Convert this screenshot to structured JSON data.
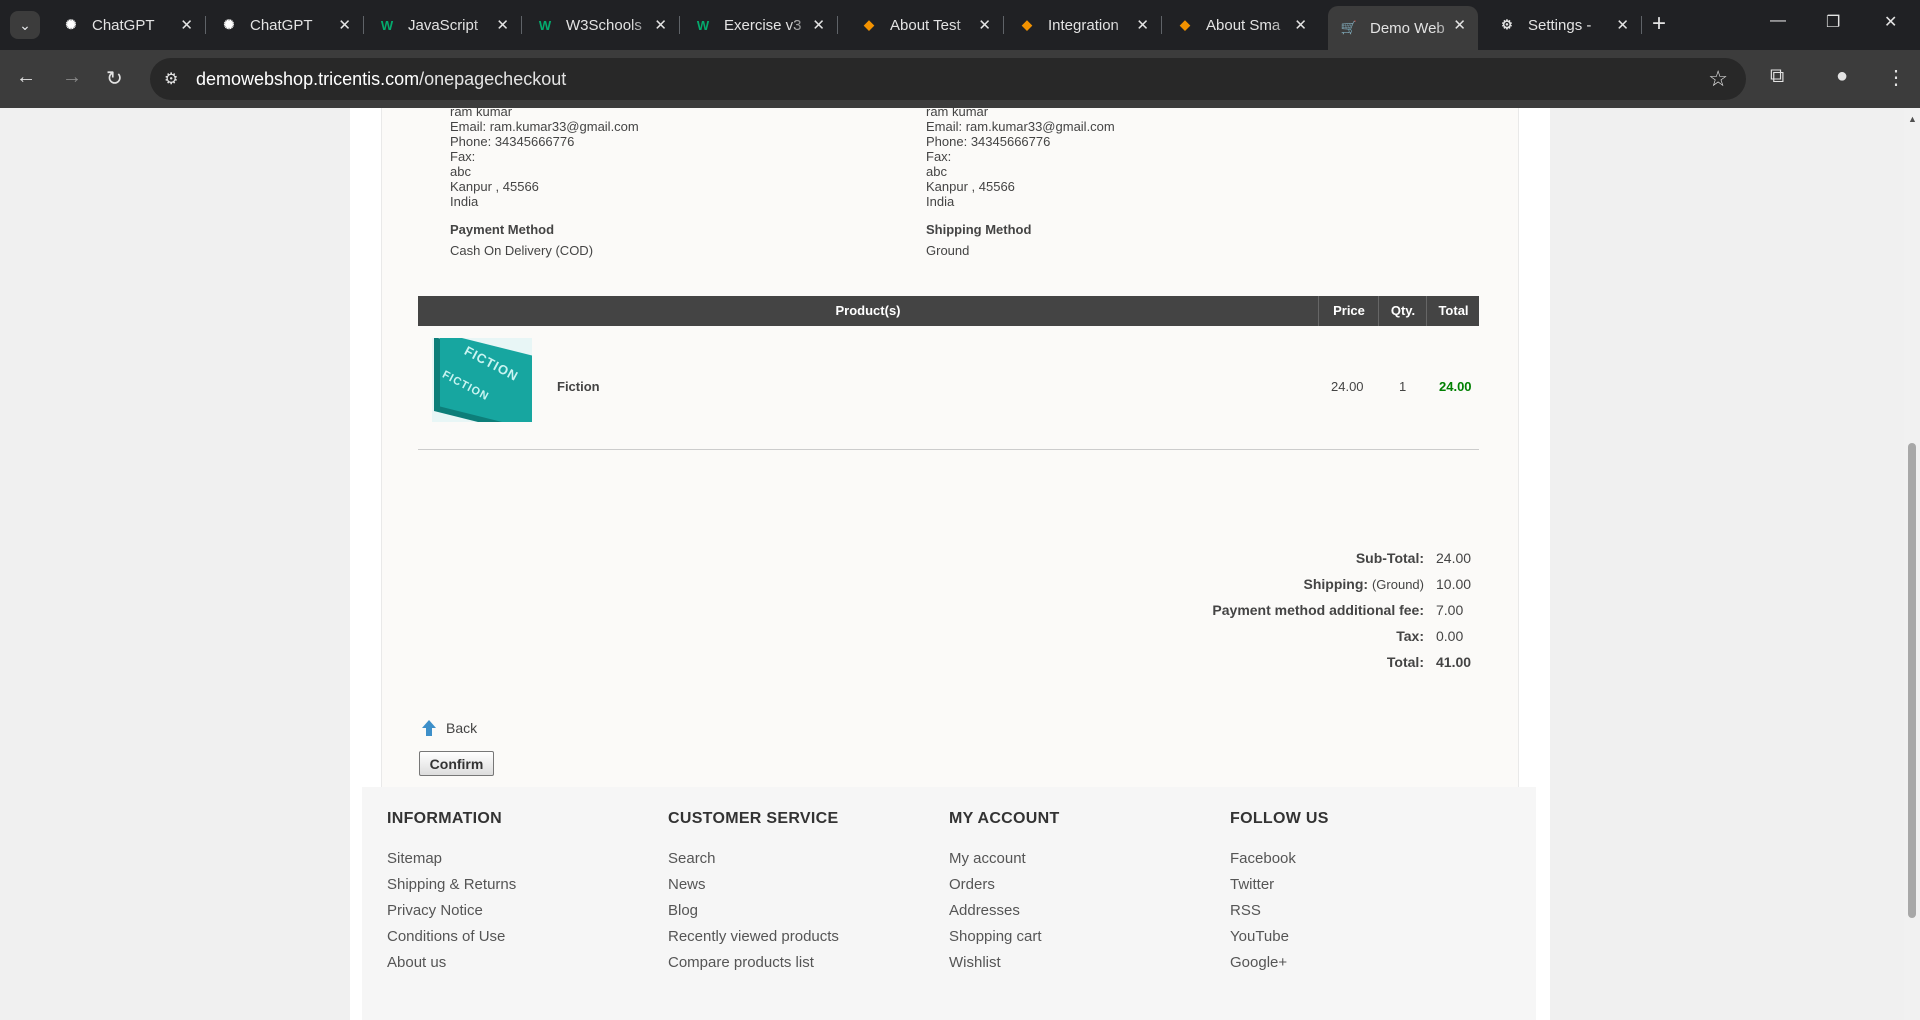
{
  "browser": {
    "tabs": [
      {
        "title": "ChatGPT",
        "icon": "chatgpt-icon"
      },
      {
        "title": "ChatGPT",
        "icon": "chatgpt-icon"
      },
      {
        "title": "JavaScript",
        "icon": "w3schools-icon"
      },
      {
        "title": "W3Schools",
        "icon": "w3schools-icon"
      },
      {
        "title": "Exercise v3",
        "icon": "w3schools-icon"
      },
      {
        "title": "About Test",
        "icon": "tosca-icon"
      },
      {
        "title": "Integration",
        "icon": "tosca-icon"
      },
      {
        "title": "About Sma",
        "icon": "tosca-icon"
      },
      {
        "title": "Demo Web",
        "icon": "cart-icon"
      },
      {
        "title": "Settings - ",
        "icon": "gear-icon"
      }
    ],
    "url_host": "demowebshop.tricentis.com",
    "url_path": "/onepagecheckout"
  },
  "billing": {
    "name": "ram kumar",
    "email": "Email: ram.kumar33@gmail.com",
    "phone": "Phone: 34345666776",
    "fax": "Fax:",
    "address": "abc",
    "city": "Kanpur , 45566",
    "country": "India"
  },
  "shipping": {
    "name": "ram kumar",
    "email": "Email: ram.kumar33@gmail.com",
    "phone": "Phone: 34345666776",
    "fax": "Fax:",
    "address": "abc",
    "city": "Kanpur , 45566",
    "country": "India"
  },
  "payment_method": {
    "label": "Payment Method",
    "value": "Cash On Delivery (COD)"
  },
  "shipping_method": {
    "label": "Shipping Method",
    "value": "Ground"
  },
  "cart": {
    "headers": {
      "products": "Product(s)",
      "price": "Price",
      "qty": "Qty.",
      "total": "Total"
    },
    "items": [
      {
        "name": "Fiction",
        "price": "24.00",
        "qty": "1",
        "total": "24.00",
        "image_text": "FICTION"
      }
    ]
  },
  "totals": {
    "subtotal_label": "Sub-Total:",
    "subtotal": "24.00",
    "shipping_label": "Shipping:",
    "shipping_note": "(Ground)",
    "shipping": "10.00",
    "fee_label": "Payment method additional fee:",
    "fee": "7.00",
    "tax_label": "Tax:",
    "tax": "0.00",
    "total_label": "Total:",
    "total": "41.00"
  },
  "actions": {
    "back": "Back",
    "confirm": "Confirm"
  },
  "footer": {
    "columns": [
      {
        "title": "INFORMATION",
        "links": [
          "Sitemap",
          "Shipping & Returns",
          "Privacy Notice",
          "Conditions of Use",
          "About us"
        ]
      },
      {
        "title": "CUSTOMER SERVICE",
        "links": [
          "Search",
          "News",
          "Blog",
          "Recently viewed products",
          "Compare products list"
        ]
      },
      {
        "title": "MY ACCOUNT",
        "links": [
          "My account",
          "Orders",
          "Addresses",
          "Shopping cart",
          "Wishlist"
        ]
      },
      {
        "title": "FOLLOW US",
        "links": [
          "Facebook",
          "Twitter",
          "RSS",
          "YouTube",
          "Google+"
        ]
      }
    ]
  },
  "colors": {
    "accent_green": "#018002",
    "header_bg": "#444444",
    "chrome_bg": "#202124"
  }
}
